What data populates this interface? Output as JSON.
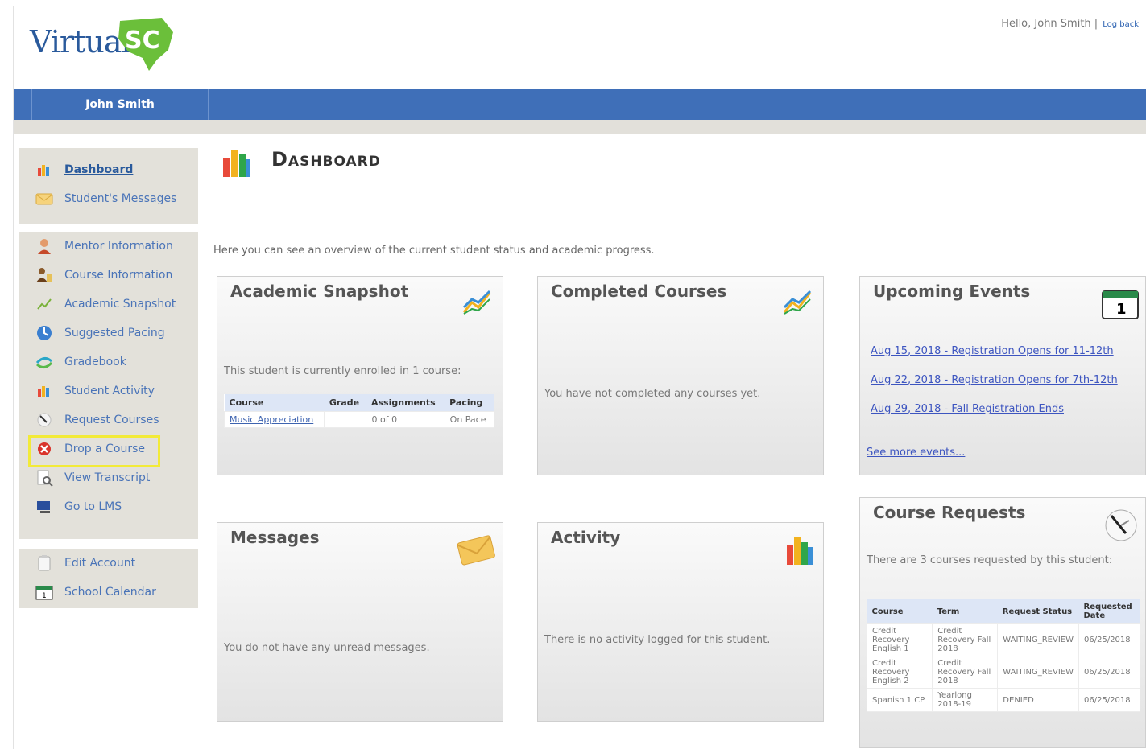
{
  "header": {
    "logo_text": "Virtual",
    "logo_suffix": "SC",
    "greeting": "Hello, John Smith |",
    "logout_label": "Log back"
  },
  "navbar": {
    "user_link": "John Smith"
  },
  "sidebar": {
    "group1": [
      {
        "label": "Dashboard",
        "icon": "chart-icon"
      },
      {
        "label": "Student's Messages",
        "icon": "envelope-icon"
      }
    ],
    "group2": [
      {
        "label": "Mentor Information",
        "icon": "mentor-icon"
      },
      {
        "label": "Course Information",
        "icon": "course-info-icon"
      },
      {
        "label": "Academic Snapshot",
        "icon": "snapshot-icon"
      },
      {
        "label": "Suggested Pacing",
        "icon": "pacing-icon"
      },
      {
        "label": "Gradebook",
        "icon": "gradebook-icon"
      },
      {
        "label": "Student Activity",
        "icon": "activity-icon"
      },
      {
        "label": "Request Courses",
        "icon": "request-icon"
      },
      {
        "label": "Drop a Course",
        "icon": "drop-icon"
      },
      {
        "label": "View Transcript",
        "icon": "transcript-icon"
      },
      {
        "label": "Go to LMS",
        "icon": "lms-icon"
      }
    ],
    "group3": [
      {
        "label": "Edit Account",
        "icon": "edit-account-icon"
      },
      {
        "label": "School Calendar",
        "icon": "calendar-icon"
      }
    ]
  },
  "main": {
    "title": "Dashboard",
    "intro": "Here you can see an overview of the current student status and academic progress."
  },
  "panels": {
    "snapshot": {
      "title": "Academic Snapshot",
      "text": "This student is currently enrolled in 1 course:",
      "headers": [
        "Course",
        "Grade",
        "Assignments",
        "Pacing"
      ],
      "rows": [
        [
          "Music Appreciation",
          "",
          "0 of 0",
          "On Pace"
        ]
      ]
    },
    "completed": {
      "title": "Completed Courses",
      "text": "You have not completed any courses yet."
    },
    "events": {
      "title": "Upcoming Events",
      "items": [
        "Aug 15, 2018 - Registration Opens for 11-12th",
        "Aug 22, 2018 - Registration Opens for 7th-12th",
        "Aug 29, 2018 - Fall Registration Ends"
      ],
      "more": "See more events..."
    },
    "messages": {
      "title": "Messages",
      "text": "You do not have any unread messages."
    },
    "activity": {
      "title": "Activity",
      "text": "There is no activity logged for this student."
    },
    "requests": {
      "title": "Course Requests",
      "text": "There are 3 courses requested by this student:",
      "headers": [
        "Course",
        "Term",
        "Request Status",
        "Requested Date"
      ],
      "rows": [
        [
          "Credit Recovery English 1",
          "Credit Recovery Fall 2018",
          "WAITING_REVIEW",
          "06/25/2018"
        ],
        [
          "Credit Recovery English 2",
          "Credit Recovery Fall 2018",
          "WAITING_REVIEW",
          "06/25/2018"
        ],
        [
          "Spanish 1 CP",
          "Yearlong 2018-19",
          "DENIED",
          "06/25/2018"
        ]
      ]
    }
  },
  "colors": {
    "navbar": "#3f6fb8",
    "link": "#4a74b8",
    "highlight": "#f2ea38",
    "logo_green": "#6bbf3a"
  }
}
